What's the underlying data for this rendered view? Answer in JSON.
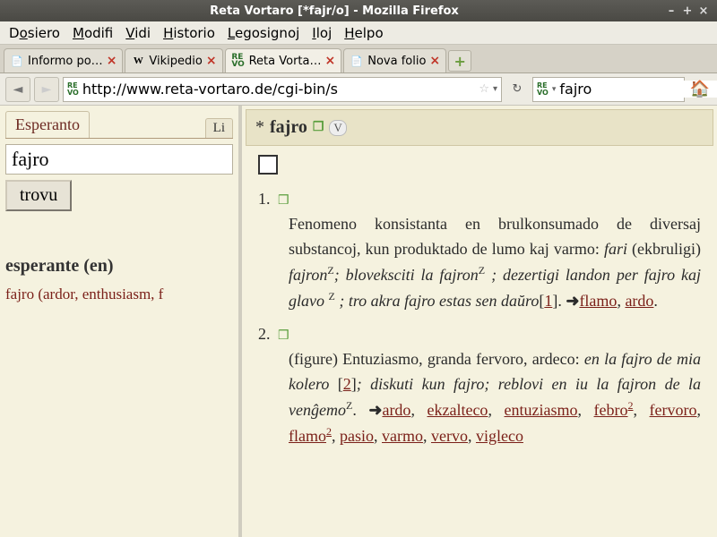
{
  "window": {
    "title": "Reta Vortaro [*fajr/o] - Mozilla Firefox"
  },
  "menu": {
    "dosiero": "Dosiero",
    "modifi": "Modifi",
    "vidi": "Vidi",
    "historio": "Historio",
    "legosignoj": "Legosignoj",
    "iloj": "Iloj",
    "helpo": "Helpo"
  },
  "tabs": [
    {
      "label": "Informo po…",
      "favglyph": "📄"
    },
    {
      "label": "Vikipedio",
      "favglyph": "W"
    },
    {
      "label": "Reta Vorta…",
      "favglyph": "RE"
    },
    {
      "label": "Nova folio",
      "favglyph": "📄"
    }
  ],
  "nav": {
    "url": "http://www.reta-vortaro.de/cgi-bin/s",
    "search": "fajro",
    "favglyph": "RE"
  },
  "left": {
    "tab1": "Esperanto",
    "tab2": "Li",
    "input": "fajro",
    "button": "trovu",
    "heading": "esperante (en)",
    "result_word": "fajro",
    "result_trans": " (ardor, enthusiasm, f"
  },
  "entry": {
    "headword": "fajro",
    "asterisk": "*",
    "def1_num": "1.",
    "def1": "Fenomeno konsistanta en brulkonsumado de diversaj substancoj, kun produktado de lumo kaj varmo:",
    "def1_ex1a": "fari",
    "def1_ex1b": "(ekbruligi)",
    "def1_ex1c": "fajron",
    "def1_ex2": "bloveksciti la fajron",
    "def1_ex3": "; dezertigi landon per fajro kaj glavo ",
    "def1_ex4": "; tro akra fajro estas sen daŭro",
    "def1_ref_open": "[",
    "def1_ref": "1",
    "def1_ref_close": "]. ",
    "def1_link1": "flamo",
    "def1_link2": "ardo",
    "def2_num": "2.",
    "def2_intro": "(figure) Entuziasmo, granda fervoro, ardeco:",
    "def2_ex1": "en la fajro de mia kolero ",
    "def2_ref2": "2",
    "def2_ex2": "; diskuti kun fajro; reblovi en iu la fajron de la venĝemo",
    "def2_links": [
      "ardo",
      "ekzalteco",
      "entuziasmo",
      "febro"
    ],
    "def2_links2": [
      "fervoro",
      "flamo",
      "pasio",
      "varmo",
      "vervo",
      "vigleco"
    ]
  }
}
